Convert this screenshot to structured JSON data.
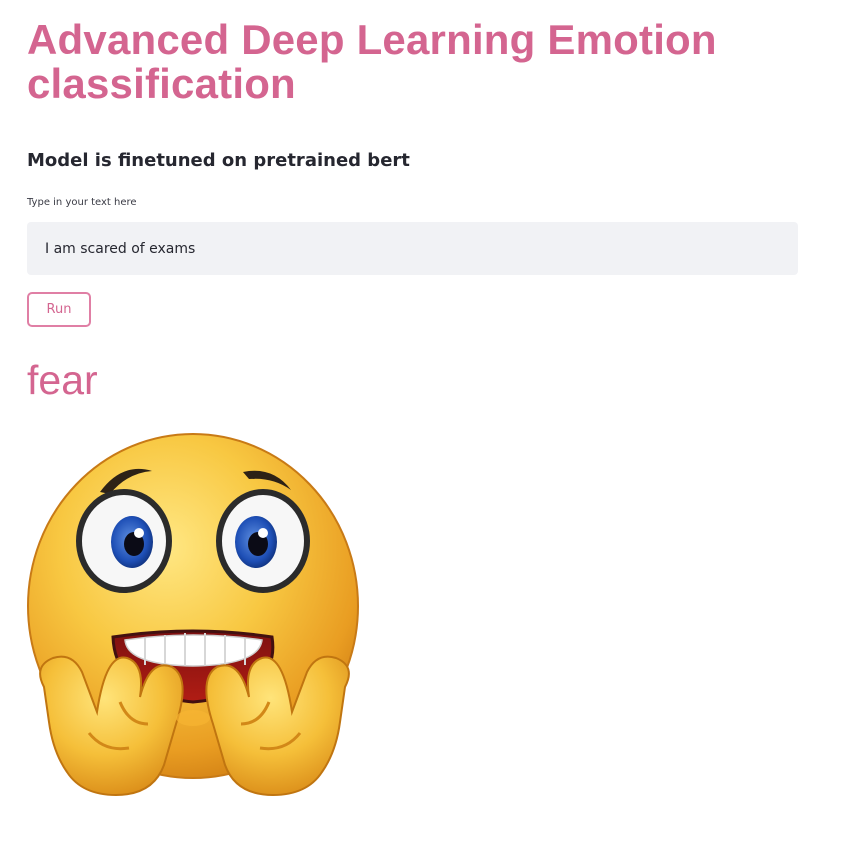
{
  "header": {
    "title": "Advanced Deep Learning Emotion classification",
    "subtitle": "Model is finetuned on pretrained bert"
  },
  "form": {
    "input_label": "Type in your text here",
    "input_value": "I am scared of exams",
    "run_label": "Run"
  },
  "output": {
    "emotion": "fear",
    "image_icon": "fearful-face-emoji"
  },
  "colors": {
    "accent": "#d46590",
    "input_background": "#f1f2f5",
    "text": "#262730",
    "emoji_yellow": "#f6c433"
  }
}
